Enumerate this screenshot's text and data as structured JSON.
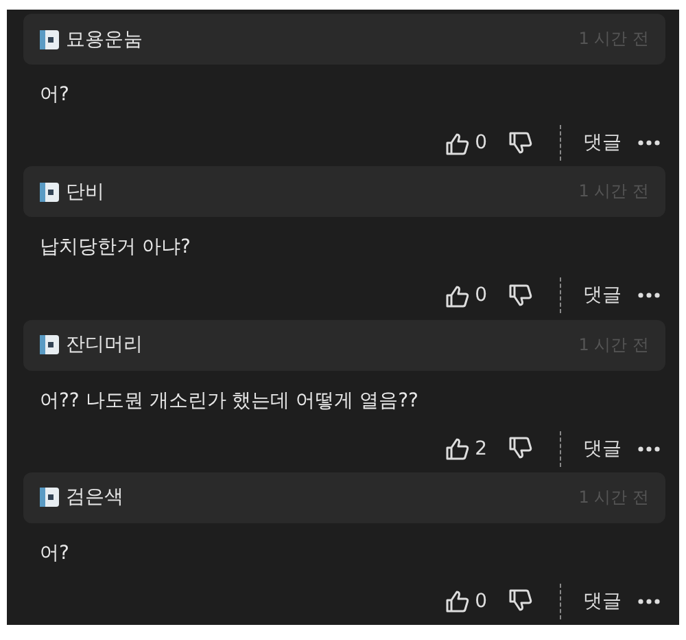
{
  "comments": [
    {
      "author": "묘용운눔",
      "time": "1 시간 전",
      "text": "어?",
      "likes": "0",
      "reply_label": "댓글"
    },
    {
      "author": "단비",
      "time": "1 시간 전",
      "text": "납치당한거 아냐?",
      "likes": "0",
      "reply_label": "댓글"
    },
    {
      "author": "잔디머리",
      "time": "1 시간 전",
      "text": "어?? 나도뭔 개소린가 했는데 어떻게 열음??",
      "likes": "2",
      "reply_label": "댓글"
    },
    {
      "author": "검은색",
      "time": "1 시간 전",
      "text": "어?",
      "likes": "0",
      "reply_label": "댓글"
    }
  ]
}
